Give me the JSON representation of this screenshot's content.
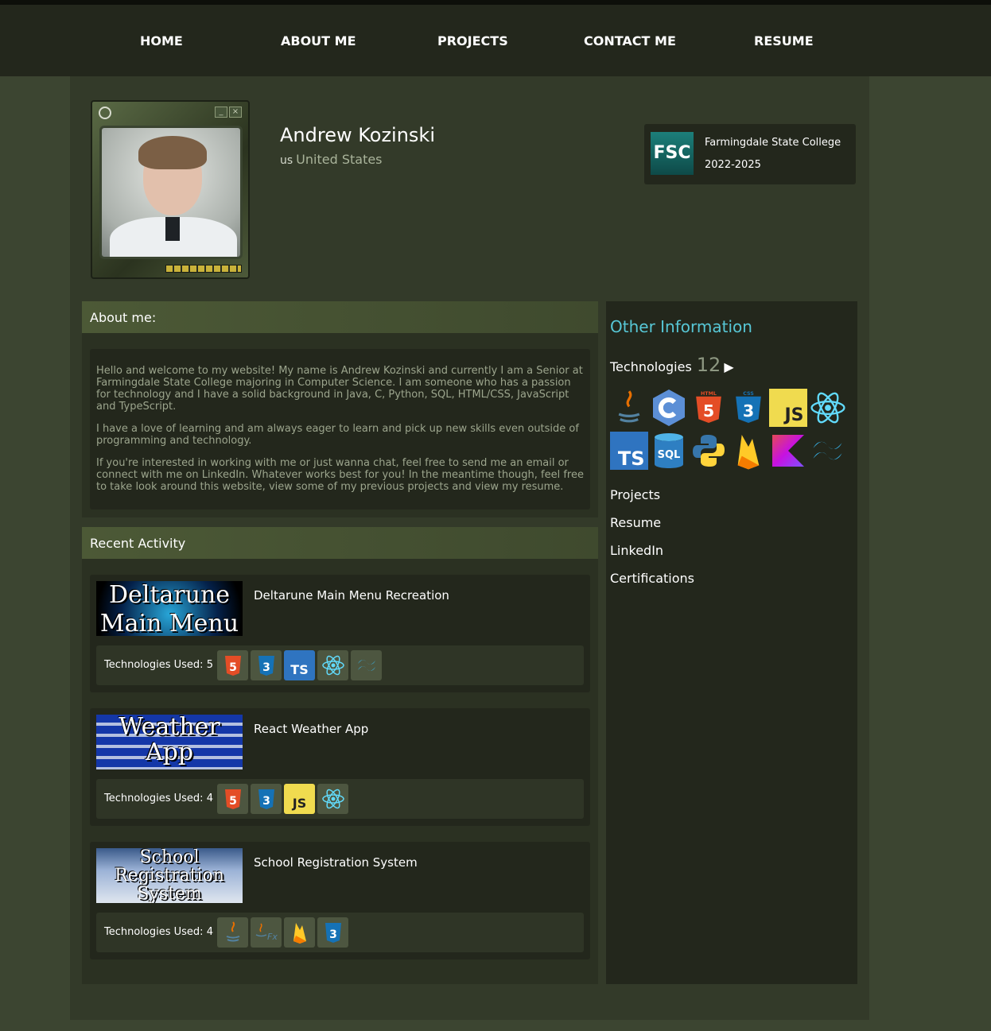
{
  "nav": {
    "home": "HOME",
    "about": "ABOUT ME",
    "projects": "PROJECTS",
    "contact": "CONTACT ME",
    "resume": "RESUME"
  },
  "profile": {
    "name": "Andrew Kozinski",
    "country_code": "us",
    "country": "United States"
  },
  "education": {
    "logo_text": "FSC",
    "school": "Farmingdale State College",
    "years": "2022-2025"
  },
  "about": {
    "header": "About me:",
    "paragraphs": [
      "Hello and welcome to my website! My name is Andrew Kozinski and currently I am a Senior at Farmingdale State College majoring in Computer Science. I am someone who has a passion for technology and I have a solid background in Java, C, Python, SQL, HTML/CSS, JavaScript and TypeScript.",
      "I have a love of learning and am always eager to learn and pick up new skills even outside of programming and technology.",
      "If you're interested in working with me or just wanna chat, feel free to send me an email or connect with me on LinkedIn. Whatever works best for you! In the meantime though, feel free to take look around this website, view some of my previous projects and view my resume."
    ]
  },
  "activity": {
    "header": "Recent Activity",
    "items": [
      {
        "thumb_text_1": "Deltarune",
        "thumb_text_2": "Main Menu",
        "title": "Deltarune Main Menu Recreation",
        "tech_label": "Technologies Used: 5",
        "icons": [
          "html5-icon",
          "css3-icon",
          "typescript-icon",
          "react-icon",
          "tailwind-icon"
        ]
      },
      {
        "thumb_text_1": "Weather",
        "thumb_text_2": "App",
        "title": "React Weather App",
        "tech_label": "Technologies Used: 4",
        "icons": [
          "html5-icon",
          "css3-icon",
          "javascript-icon",
          "react-icon"
        ]
      },
      {
        "thumb_text_1": "School",
        "thumb_text_2": "Registration",
        "thumb_text_3": "System",
        "title": "School Registration System",
        "tech_label": "Technologies Used: 4",
        "icons": [
          "java-icon",
          "javafx-icon",
          "firebase-icon",
          "css3-icon"
        ]
      }
    ]
  },
  "sidebar": {
    "title": "Other Information",
    "tech_label": "Technologies",
    "tech_count": "12",
    "tech_arrow": "▶",
    "icons": [
      "java-icon",
      "c-icon",
      "html5-icon",
      "css3-icon",
      "javascript-icon",
      "react-icon",
      "typescript-icon",
      "sql-icon",
      "python-icon",
      "firebase-icon",
      "kotlin-icon",
      "tailwind-icon"
    ],
    "links": [
      "Projects",
      "Resume",
      "LinkedIn",
      "Certifications"
    ]
  },
  "colors": {
    "accent": "#57c7d6",
    "nav_bg": "#23271c",
    "page_bg": "#333a29"
  }
}
